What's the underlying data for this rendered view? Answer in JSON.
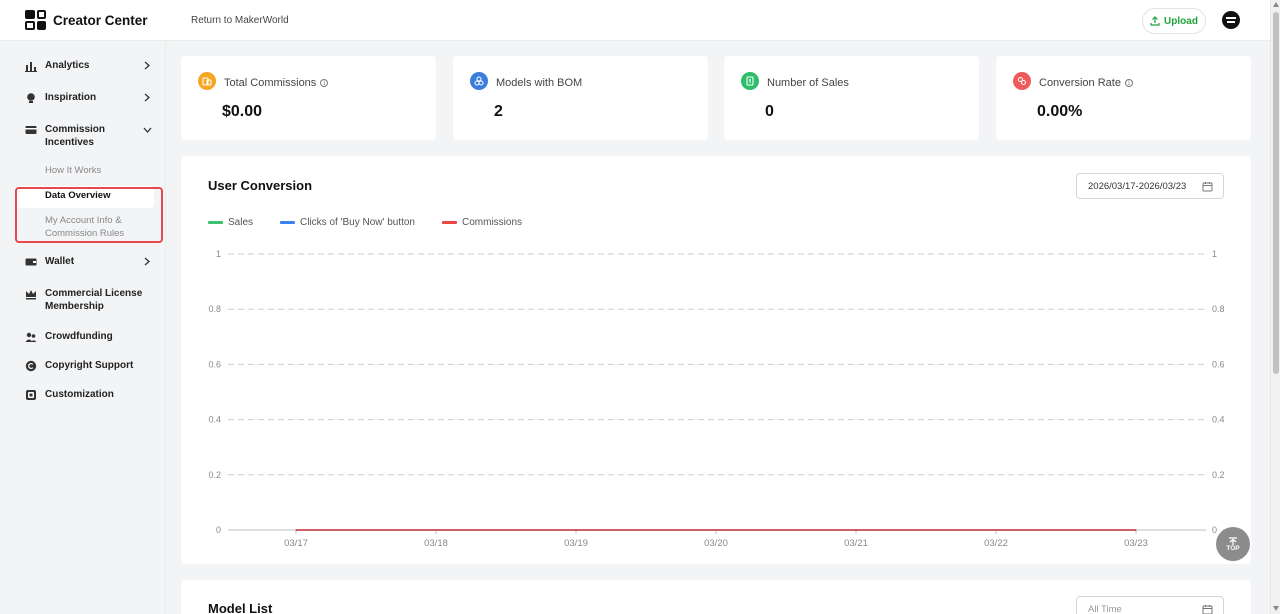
{
  "header": {
    "brand": "Creator Center",
    "return_link": "Return to MakerWorld",
    "upload_label": "Upload"
  },
  "sidebar": {
    "items": [
      {
        "label": "Analytics",
        "icon": "bar-chart-icon"
      },
      {
        "label": "Inspiration",
        "icon": "lightbulb-icon"
      },
      {
        "label": "Commission Incentives",
        "icon": "wallet-card-icon"
      },
      {
        "label": "Wallet",
        "icon": "wallet-icon"
      },
      {
        "label": "Commercial License Membership",
        "icon": "crown-icon"
      },
      {
        "label": "Crowdfunding",
        "icon": "people-icon"
      },
      {
        "label": "Copyright Support",
        "icon": "copyright-icon"
      },
      {
        "label": "Customization",
        "icon": "layers-icon"
      }
    ],
    "sub_items": [
      {
        "label": "How It Works"
      },
      {
        "label": "Data Overview"
      },
      {
        "label": "My Account Info & Commission Rules"
      }
    ]
  },
  "stats": [
    {
      "label": "Total Commissions",
      "value": "$0.00",
      "color": "#f5a623",
      "icon": "coins-icon"
    },
    {
      "label": "Models with BOM",
      "value": "2",
      "color": "#3b7ddd",
      "icon": "cubes-icon"
    },
    {
      "label": "Number of Sales",
      "value": "0",
      "color": "#2ebd6b",
      "icon": "receipt-icon"
    },
    {
      "label": "Conversion Rate",
      "value": "0.00%",
      "color": "#ef5a5a",
      "icon": "exchange-icon"
    }
  ],
  "conversion": {
    "title": "User Conversion",
    "date_range": "2026/03/17-2026/03/23"
  },
  "chart_data": {
    "type": "line",
    "x": [
      "03/17",
      "03/18",
      "03/19",
      "03/20",
      "03/21",
      "03/22",
      "03/23"
    ],
    "yticks_left": [
      "0",
      "0.2",
      "0.4",
      "0.6",
      "0.8",
      "1"
    ],
    "yticks_right": [
      "0",
      "0.2",
      "0.4",
      "0.6",
      "0.8",
      "1"
    ],
    "ylim": [
      0,
      1
    ],
    "grid": true,
    "legend_position": "top-left",
    "series": [
      {
        "name": "Sales",
        "color": "#3cc36f",
        "values": [
          0,
          0,
          0,
          0,
          0,
          0,
          0
        ]
      },
      {
        "name": "Clicks of 'Buy Now' button",
        "color": "#3b82f6",
        "values": [
          0,
          0,
          0,
          0,
          0,
          0,
          0
        ]
      },
      {
        "name": "Commissions",
        "color": "#ef4444",
        "values": [
          0,
          0,
          0,
          0,
          0,
          0,
          0
        ]
      }
    ]
  },
  "model_list": {
    "title": "Model List",
    "time_filter": "All Time"
  },
  "back_to_top": "TOP"
}
